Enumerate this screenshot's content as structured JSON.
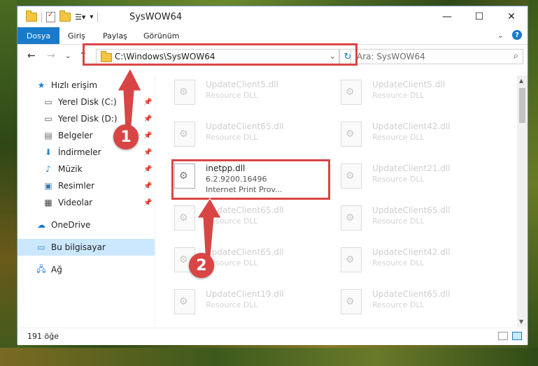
{
  "window": {
    "title": "SysWOW64"
  },
  "ribbon": {
    "tabs": [
      "Dosya",
      "Giriş",
      "Paylaş",
      "Görünüm"
    ],
    "help": "?"
  },
  "nav": {
    "address": "C:\\Windows\\SysWOW64",
    "search_placeholder": "Ara: SysWOW64"
  },
  "sidebar": {
    "items": [
      {
        "label": "Hızlı erişim"
      },
      {
        "label": "Yerel Disk (C:)"
      },
      {
        "label": "Yerel Disk (D:)"
      },
      {
        "label": "Belgeler"
      },
      {
        "label": "İndirmeler"
      },
      {
        "label": "Müzik"
      },
      {
        "label": "Resimler"
      },
      {
        "label": "Videolar"
      },
      {
        "label": "OneDrive"
      },
      {
        "label": "Bu bilgisayar"
      },
      {
        "label": "Ağ"
      }
    ]
  },
  "files": [
    {
      "name": "UpdateClient5.dll",
      "desc": "Resource DLL"
    },
    {
      "name": "UpdateClient5.dll",
      "desc": "Resource DLL"
    },
    {
      "name": "UpdateClient65.dll",
      "desc": "Resource DLL"
    },
    {
      "name": "UpdateClient42.dll",
      "desc": "Resource DLL"
    },
    {
      "name": "inetpp.dll",
      "desc": "6.2.9200.16496",
      "extra": "Internet Print Prov..."
    },
    {
      "name": "UpdateClient21.dll",
      "desc": "Resource DLL"
    },
    {
      "name": "UpdateClient65.dll",
      "desc": "Resource DLL"
    },
    {
      "name": "UpdateClient65.dll",
      "desc": "Resource DLL"
    },
    {
      "name": "UpdateClient65.dll",
      "desc": "Resource DLL"
    },
    {
      "name": "UpdateClient42.dll",
      "desc": "Resource DLL"
    },
    {
      "name": "UpdateClient19.dll",
      "desc": "Resource DLL"
    },
    {
      "name": "UpdateClient65.dll",
      "desc": "Resource DLL"
    }
  ],
  "status": {
    "count": "191 öğe"
  },
  "callouts": [
    "1",
    "2"
  ],
  "colors": {
    "accent": "#1979ca",
    "callout": "#d94545",
    "selected": "#cce8ff"
  }
}
